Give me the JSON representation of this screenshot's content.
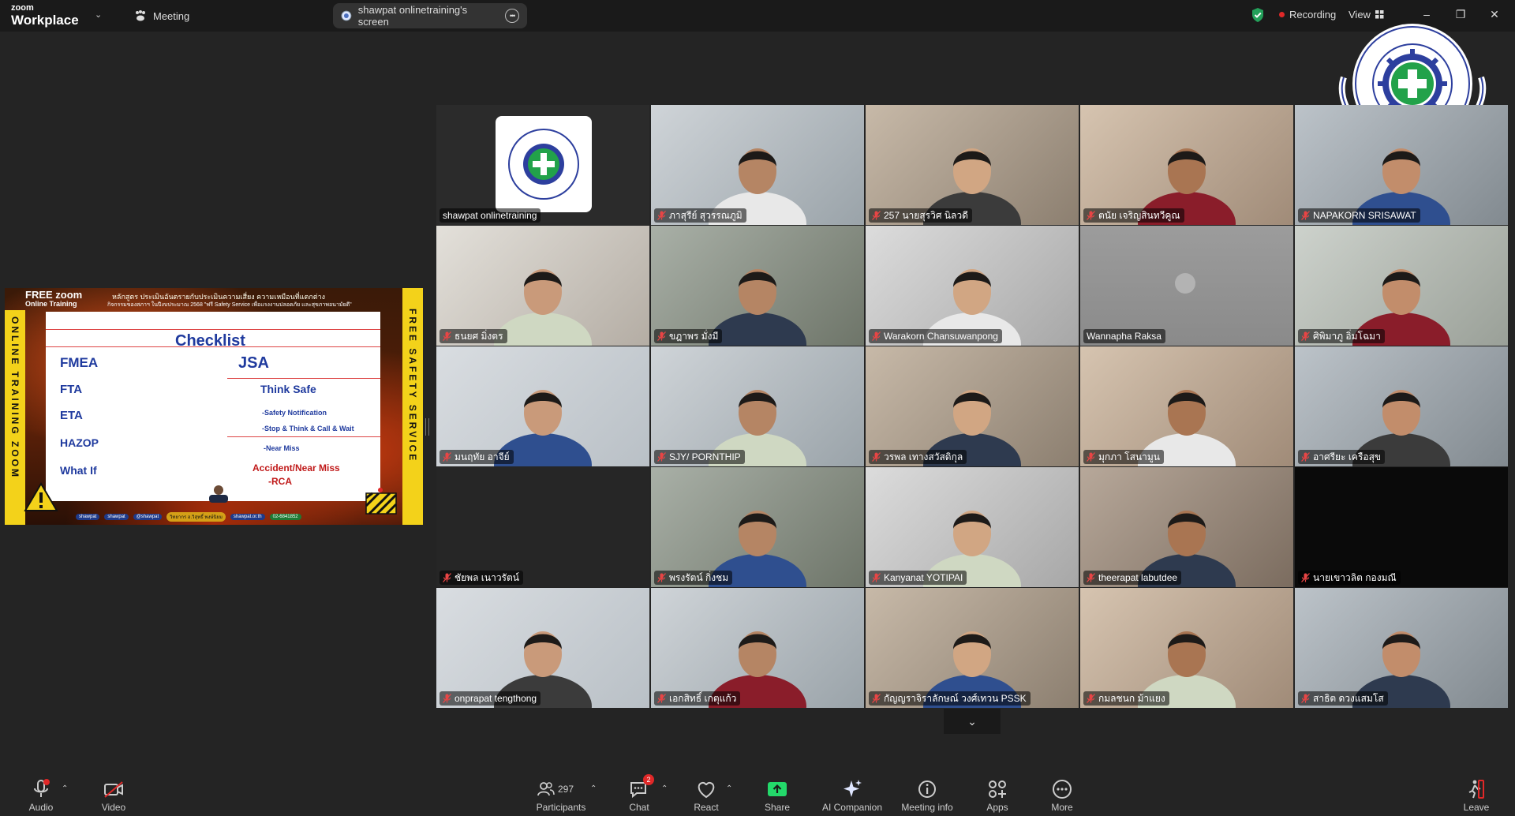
{
  "titlebar": {
    "brand_small": "zoom",
    "brand_large": "Workplace",
    "meeting_label": "Meeting",
    "share_tab_label": "shawpat onlinetraining's screen",
    "recording_label": "Recording",
    "view_label": "View",
    "colors": {
      "recording": "#e02828",
      "shield": "#23a05a"
    }
  },
  "slide": {
    "header_free": "FREE zoom",
    "header_online": "Online Training",
    "header_title": "หลักสูตร ประเมินอันตรายกับประเมินความเสี่ยง ความเหมือนที่แตกต่าง",
    "header_sub": "กิจกรรมของสภาฯ ในปีงบประมาณ 2568 \"ฟรี Safety Service เพื่อแรงงานปลอดภัย และสุขภาพอนามัยดี\"",
    "side_left": "ONLINE TRAINING ZOOM",
    "side_right": "FREE SAFETY SERVICE",
    "board": {
      "title": "Checklist",
      "left_items": [
        "FMEA",
        "FTA",
        "ETA",
        "HAZOP",
        "What If"
      ],
      "jsa": "JSA",
      "think_safe": "Think Safe",
      "sub_items": [
        "-Safety Notification",
        "-Stop & Think & Call & Wait",
        "-Near Miss"
      ],
      "accident": "Accident/Near Miss",
      "rca": "-RCA"
    },
    "footer": [
      "shawpat",
      "shawpat",
      "@shawpat",
      "วิทยากร อ.วิสุทธิ์ พงษ์นิยม",
      "shawpat.or.th",
      "02-6841852"
    ]
  },
  "participants": [
    {
      "name": "shawpat onlinetraining",
      "muted": false,
      "type": "logo",
      "active": true
    },
    {
      "name": "ภาสุรีย์ สุวรรณภูมิ",
      "muted": true,
      "type": "video"
    },
    {
      "name": "257 นายสุรวิศ นิลวดี",
      "muted": true,
      "type": "video"
    },
    {
      "name": "ตนัย เจริญสินทวีคูณ",
      "muted": true,
      "type": "video"
    },
    {
      "name": "NAPAKORN SRISAWAT",
      "muted": true,
      "type": "video"
    },
    {
      "name": "ธนยศ มิ่งตร",
      "muted": true,
      "type": "video"
    },
    {
      "name": "ขฎาพร มั่งมี",
      "muted": true,
      "type": "video"
    },
    {
      "name": "Warakorn Chansuwanpong",
      "muted": true,
      "type": "video"
    },
    {
      "name": "Wannapha Raksa",
      "muted": false,
      "type": "blank"
    },
    {
      "name": "ศิพิมาภู อิ่มโฉมา",
      "muted": true,
      "type": "video"
    },
    {
      "name": "มนฤทัย อาจีย์",
      "muted": true,
      "type": "video"
    },
    {
      "name": "SJY/ PORNTHIP",
      "muted": true,
      "type": "video"
    },
    {
      "name": "วรพล เทางสวัสดิกุล",
      "muted": true,
      "type": "video"
    },
    {
      "name": "มุกภา โสนามูน",
      "muted": true,
      "type": "video"
    },
    {
      "name": "อาศรียะ เครือสุข",
      "muted": true,
      "type": "video"
    },
    {
      "name": "ชัยพล เนาวรัตน์",
      "muted": true,
      "type": "dark"
    },
    {
      "name": "พรงรัตน์ กิ่งชม",
      "muted": true,
      "type": "video"
    },
    {
      "name": "Kanyanat YOTIPAI",
      "muted": true,
      "type": "video"
    },
    {
      "name": "theerapat labutdee",
      "muted": true,
      "type": "video"
    },
    {
      "name": "นายเขาวลิต กองมณี",
      "muted": true,
      "type": "black"
    },
    {
      "name": "onprapat tengthong",
      "muted": true,
      "type": "video"
    },
    {
      "name": "เอกสิทธิ์ เกตุแก้ว",
      "muted": true,
      "type": "video"
    },
    {
      "name": "กัญญราจิราลักษณ์ วงศ์เทวน PSSK",
      "muted": true,
      "type": "video"
    },
    {
      "name": "กมลชนก ม้าแยง",
      "muted": true,
      "type": "video"
    },
    {
      "name": "สาธิต ดวงแสมโส",
      "muted": true,
      "type": "video"
    }
  ],
  "toolbar": {
    "audio": "Audio",
    "video": "Video",
    "participants": "Participants",
    "participants_count": "297",
    "chat": "Chat",
    "chat_badge": "2",
    "react": "React",
    "share": "Share",
    "ai_companion": "AI Companion",
    "meeting_info": "Meeting info",
    "apps": "Apps",
    "more": "More",
    "leave": "Leave",
    "colors": {
      "share": "#23d96a",
      "leave": "#e02828"
    }
  }
}
